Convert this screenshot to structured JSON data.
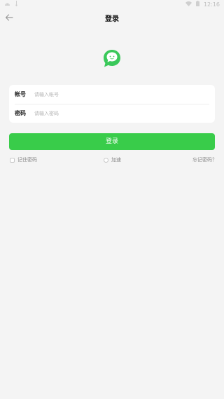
{
  "status_bar": {
    "time": "12:16",
    "icons": [
      "android-icon",
      "usb-icon",
      "wifi-icon",
      "battery-icon"
    ]
  },
  "header": {
    "title": "登录",
    "back_icon": "arrow-left-icon"
  },
  "logo": {
    "icon": "chat-bubble-icon",
    "color": "#3ac85a"
  },
  "form": {
    "account_label": "帐号",
    "account_placeholder": "请输入帐号",
    "account_value": "",
    "password_label": "密码",
    "password_placeholder": "请输入密码",
    "password_value": ""
  },
  "login_button": {
    "label": "登录",
    "color": "#39cc4a"
  },
  "options": {
    "remember_label": "记住密码",
    "accelerate_label": "加速",
    "forgot_label": "忘记密码？"
  }
}
